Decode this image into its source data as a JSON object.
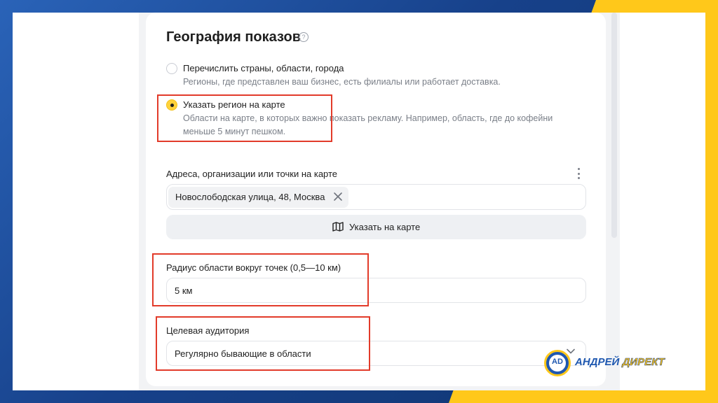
{
  "section": {
    "title": "География показов",
    "help_icon": "question-circle-icon"
  },
  "options": [
    {
      "label": "Перечислить страны, области, города",
      "description": "Регионы, где представлен ваш бизнес, есть филиалы или работает доставка.",
      "selected": false
    },
    {
      "label": "Указать регион на карте",
      "description": "Области на карте, в которых важно показать рекламу. Например, область, где до кофейни меньше 5 минут пешком.",
      "selected": true
    }
  ],
  "addresses": {
    "label": "Адреса, организации или точки на карте",
    "chip": "Новослободская улица, 48, Москва",
    "map_button": "Указать на карте"
  },
  "radius": {
    "label": "Радиус области вокруг точек (0,5—10 км)",
    "value": "5 км"
  },
  "audience": {
    "label": "Целевая аудитория",
    "value": "Регулярно бывающие в области"
  },
  "branding": {
    "logo_mark": "AD",
    "name_part1": "АНДРЕЙ",
    "name_part2": "ДИРЕКТ"
  },
  "colors": {
    "accent_yellow": "#ffc81a",
    "highlight_red": "#e23b2a",
    "brand_blue": "#1f58b0"
  }
}
